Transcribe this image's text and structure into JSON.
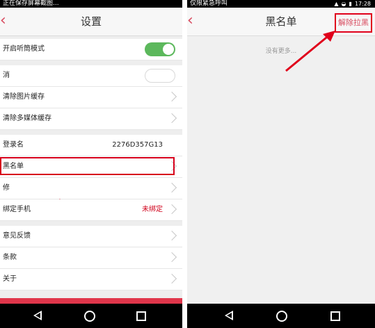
{
  "left": {
    "status_text": "正在保存屏幕截图...",
    "title": "设置",
    "rows": [
      {
        "label": "开启听筒模式"
      },
      {
        "label": "消"
      },
      {
        "label": "清除图片缓存"
      },
      {
        "label": "清除多媒体缓存"
      },
      {
        "label": "登录名",
        "value": "2276D357G13"
      },
      {
        "label": "黑名单"
      },
      {
        "label": "修"
      },
      {
        "label": "绑定手机",
        "value": "未绑定"
      },
      {
        "label": "意见反馈"
      },
      {
        "label": "条款"
      },
      {
        "label": "关于"
      }
    ],
    "toggle_on": true
  },
  "right": {
    "status_text": "仅限紧急呼叫",
    "time": "17:28",
    "title": "黑名单",
    "action": "解除拉黑",
    "empty_text": "没有更多..."
  },
  "colors": {
    "accent": "#d84a5e",
    "highlight": "#e0001b",
    "toggle": "#5cb85c"
  },
  "icons": [
    "back-chevron-icon",
    "nav-back-icon",
    "nav-home-icon",
    "nav-recent-icon",
    "wifi-icon",
    "signal-icon",
    "battery-icon"
  ]
}
